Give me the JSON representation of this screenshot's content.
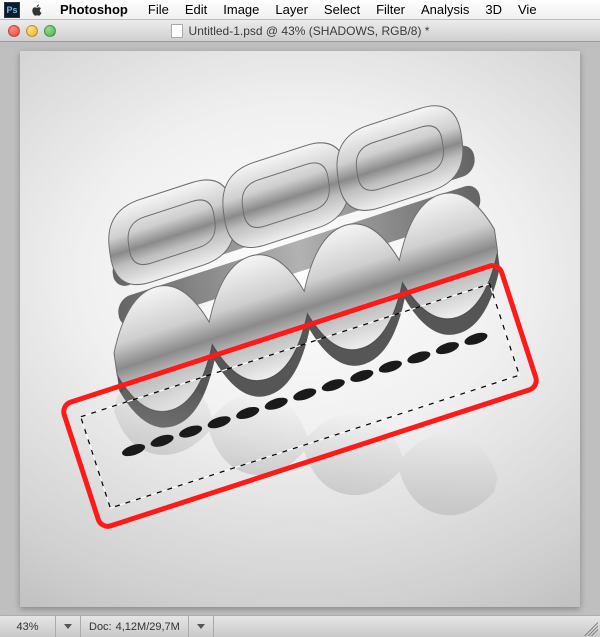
{
  "menubar": {
    "app_name": "Photoshop",
    "items": [
      "File",
      "Edit",
      "Image",
      "Layer",
      "Select",
      "Filter",
      "Analysis",
      "3D",
      "Vie"
    ]
  },
  "window": {
    "traffic": {
      "close": "close",
      "minimize": "minimize",
      "zoom": "zoom"
    },
    "title": "Untitled-1.psd @ 43% (SHADOWS, RGB/8) *"
  },
  "canvas": {
    "annotation": {
      "type": "rotated-selection-highlight",
      "color": "#ff1a1a",
      "angle_deg": -18,
      "has_marching_ants": true
    }
  },
  "statusbar": {
    "zoom": "43%",
    "doc_label": "Doc:",
    "doc_size": "4,12M/29,7M"
  }
}
